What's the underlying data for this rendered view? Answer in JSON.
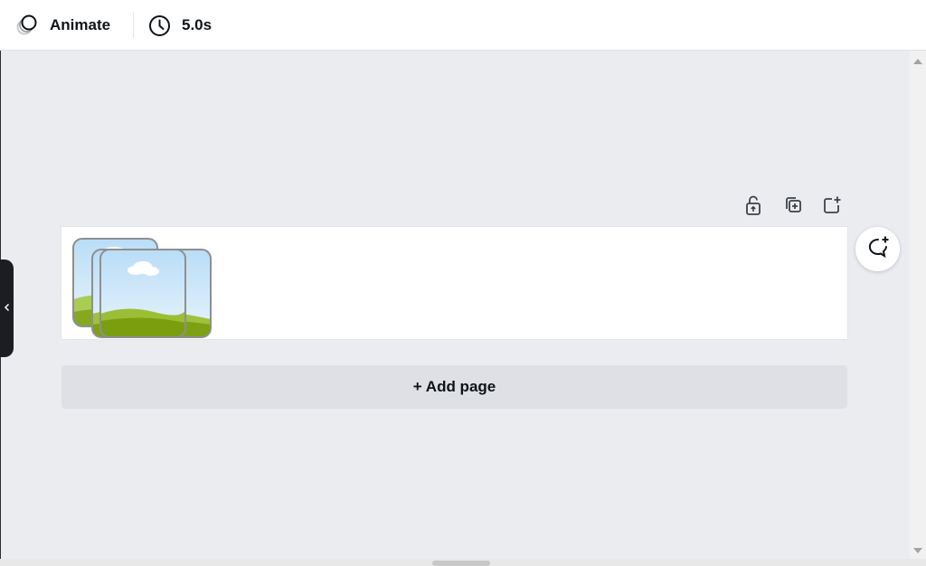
{
  "toolbar": {
    "animate_label": "Animate",
    "animate_icon": "animate-circles-icon",
    "duration_label": "5.0s",
    "duration_icon": "clock-icon"
  },
  "page_actions": [
    {
      "name": "lock-page-button",
      "icon": "unlock-icon"
    },
    {
      "name": "duplicate-page-button",
      "icon": "duplicate-icon"
    },
    {
      "name": "add-page-top-button",
      "icon": "add-page-icon"
    }
  ],
  "canvas": {
    "thumbnail_icon": "image-placeholder-stack-icon"
  },
  "comment_button": {
    "icon": "add-comment-icon"
  },
  "add_page": {
    "label": "+ Add page"
  },
  "sidebar_toggle": {
    "icon": "chevron-left-icon"
  },
  "colors": {
    "background": "#ebecf0",
    "toolbar": "#ffffff",
    "text": "#0e1318",
    "add_page_bg": "#dfe0e5",
    "side_tab": "#1b1d22"
  }
}
